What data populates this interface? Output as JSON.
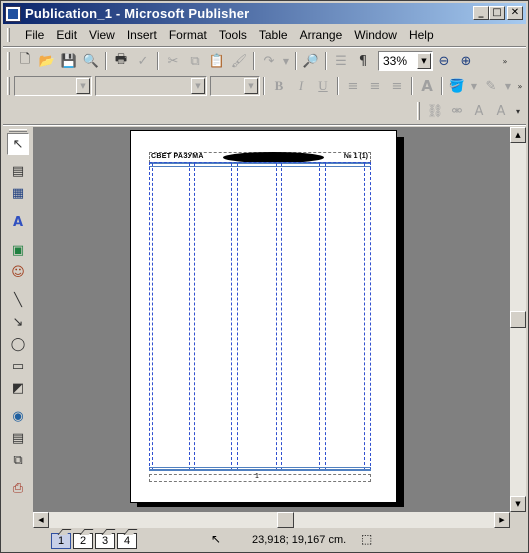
{
  "window": {
    "title": "Publication_1 - Microsoft Publisher"
  },
  "title_buttons": {
    "minimize": "_",
    "maximize": "□",
    "close": "✕"
  },
  "menu": [
    {
      "label": "File",
      "key": "file"
    },
    {
      "label": "Edit",
      "key": "edit"
    },
    {
      "label": "View",
      "key": "view"
    },
    {
      "label": "Insert",
      "key": "insert"
    },
    {
      "label": "Format",
      "key": "format"
    },
    {
      "label": "Tools",
      "key": "tools"
    },
    {
      "label": "Table",
      "key": "table"
    },
    {
      "label": "Arrange",
      "key": "arrange"
    },
    {
      "label": "Window",
      "key": "window"
    },
    {
      "label": "Help",
      "key": "help"
    }
  ],
  "standard_toolbar": {
    "icons": [
      "new-icon",
      "open-icon",
      "save-icon",
      "search-file-icon",
      "print-icon",
      "spelling-icon",
      "cut-icon",
      "copy-icon",
      "paste-icon",
      "format-painter-icon",
      "undo-icon",
      "redo-icon",
      "zoom-preview-icon",
      "columns-icon",
      "pilcrow-icon",
      "zoom-out-icon",
      "zoom-in-icon"
    ],
    "zoom": "33%"
  },
  "formatting_toolbar": {
    "style_value": "",
    "font_value": "",
    "size_value": "",
    "bold": "B",
    "italic": "I",
    "underline": "U"
  },
  "objects_toolbar": [
    "select-icon",
    "text-box-icon",
    "table-icon",
    "wordart-icon",
    "picture-icon",
    "clipart-icon",
    "line-icon",
    "arrow-icon",
    "oval-icon",
    "rectangle-icon",
    "autoshapes-icon",
    "hotspot-icon",
    "form-control-icon",
    "design-gallery-icon",
    "add-object-icon"
  ],
  "page": {
    "masthead_left": "СВЕТ РАЗУМА",
    "masthead_right": "№ 1 (1)",
    "footer_page_number": "1"
  },
  "status": {
    "pages": [
      "1",
      "2",
      "3",
      "4"
    ],
    "active_page": "1",
    "position": "23,918; 19,167 cm."
  }
}
